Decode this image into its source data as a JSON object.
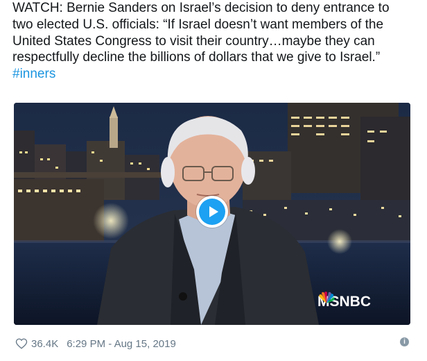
{
  "tweet": {
    "text_lines": [
      "WATCH: Bernie Sanders on Israel’s decision to deny entrance to",
      "two elected U.S. officials: “If Israel doesn’t want members of the",
      "United States Congress to visit their country…maybe they can",
      "respectfully decline the billions of dollars that we give to Israel.”"
    ],
    "hashtag": "#inners"
  },
  "media": {
    "watermark": "MSNBC",
    "play_icon": "play-icon",
    "accent_color": "#1da1f2"
  },
  "footer": {
    "like_icon": "heart-icon",
    "like_count": "36.4K",
    "timestamp": "6:29 PM - Aug 15, 2019",
    "info_icon": "info-icon",
    "info_glyph": "i"
  },
  "colors": {
    "text": "#14171a",
    "link": "#1b95e0",
    "meta": "#657786"
  }
}
